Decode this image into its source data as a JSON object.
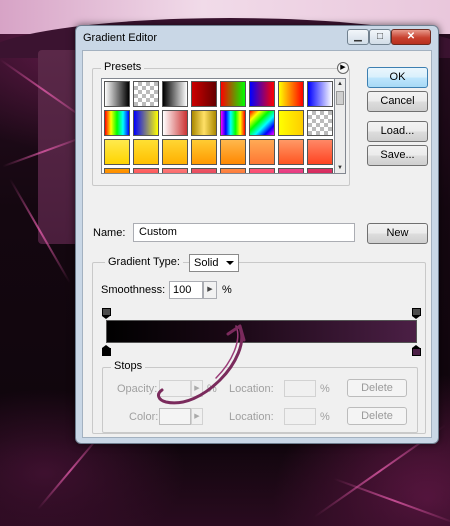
{
  "window": {
    "title": "Gradient Editor"
  },
  "presets": {
    "label": "Presets",
    "swatches": [
      [
        "linear-gradient(90deg,#ffffff,#000000)",
        "chk",
        "linear-gradient(90deg,#000,#fff)",
        "linear-gradient(90deg,#c00,#600)",
        "linear-gradient(90deg,#f00,#0f0)",
        "linear-gradient(90deg,#00f,#f00)",
        "linear-gradient(90deg,#ff0,#f00)",
        "linear-gradient(90deg,#00f,#fff)"
      ],
      [
        "linear-gradient(90deg,#f00,#ff0,#0f0,#0ff,#00f)",
        "linear-gradient(90deg,#00f,#ff0)",
        "linear-gradient(90deg,#fff,#c33)",
        "linear-gradient(90deg,#aa8800,#ffe066,#aa8800)",
        "linear-gradient(90deg,#f0f,#00f,#0ff,#0f0,#ff0,#f00)",
        "linear-gradient(135deg,#f00,#ff0,#0f0,#0ff,#00f,#f0f)",
        "linear-gradient(90deg,#ff0,#fc0)",
        "chk"
      ],
      [
        "linear-gradient(180deg,#ffea4d,#ffd400)",
        "linear-gradient(180deg,#ffe033,#ffbf00)",
        "linear-gradient(180deg,#ffd633,#ffb000)",
        "linear-gradient(180deg,#ffcc33,#ff9900)",
        "linear-gradient(180deg,#ffb84d,#ff8800)",
        "linear-gradient(180deg,#ffaa55,#ff7733)",
        "linear-gradient(180deg,#ff9966,#ff5522)",
        "linear-gradient(180deg,#ff8866,#ff4422)"
      ],
      [
        "linear-gradient(180deg,#ff9900,#ff5500)",
        "linear-gradient(180deg,#ff6666,#ee2222)",
        "linear-gradient(180deg,#ff7777,#dd3333)",
        "linear-gradient(180deg,#ee5566,#cc2233)",
        "linear-gradient(180deg,#ff8844,#ee4411)",
        "linear-gradient(180deg,#ff5577,#dd2255)",
        "linear-gradient(180deg,#ee4488,#bb1155)",
        "linear-gradient(180deg,#dd3366,#aa0033)"
      ]
    ]
  },
  "buttons": {
    "ok": "OK",
    "cancel": "Cancel",
    "load": "Load...",
    "save": "Save...",
    "new": "New",
    "delete": "Delete"
  },
  "name": {
    "label": "Name:",
    "value": "Custom"
  },
  "gradient": {
    "type_label": "Gradient Type:",
    "type_value": "Solid",
    "smoothness_label": "Smoothness:",
    "smoothness_value": "100",
    "smoothness_unit": "%",
    "start_color": "#000000",
    "end_color": "#4b1f45"
  },
  "stops": {
    "label": "Stops",
    "opacity_label": "Opacity:",
    "color_label": "Color:",
    "location_label": "Location:",
    "unit": "%"
  }
}
